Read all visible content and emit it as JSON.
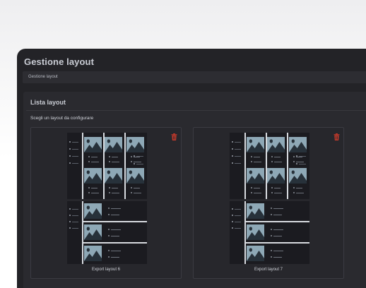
{
  "app": {
    "title": "Gestione layout",
    "breadcrumb": "Gestione layout"
  },
  "section": {
    "title": "Lista layout",
    "subtitle": "Scegli un layout da configurare"
  },
  "layouts": [
    {
      "label": "Export layout 6"
    },
    {
      "label": "Export layout 7"
    }
  ],
  "colors": {
    "background": "#232327",
    "panel": "#2a2a2f",
    "accent_delete": "#c0392b",
    "image_placeholder": "#8ea8b6"
  },
  "icons": {
    "delete": "trash-icon",
    "image": "image-placeholder-icon"
  }
}
